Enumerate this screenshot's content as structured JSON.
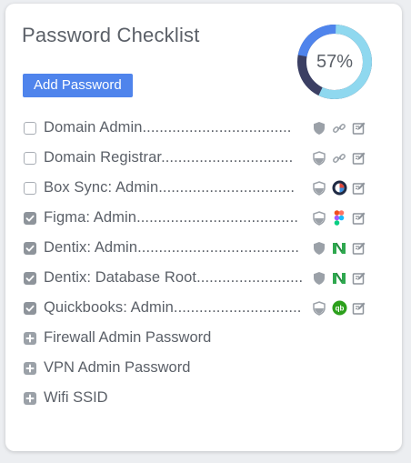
{
  "checklist": {
    "title": "Password Checklist",
    "add_button_label": "Add Password",
    "progress_label": "57%",
    "progress_fraction": 0.57,
    "colors": {
      "accent": "#4f84ec",
      "donut_dark": "#3b3f63",
      "donut_light": "#8fd8ef",
      "donut_blue": "#4f84ec"
    },
    "items": [
      {
        "label": "Domain Admin...................................",
        "checked": false,
        "shield": "shield-solid-icon",
        "service": "link-icon"
      },
      {
        "label": "Domain Registrar...............................",
        "checked": false,
        "shield": "shield-half-icon",
        "service": "link-icon"
      },
      {
        "label": "Box Sync: Admin................................",
        "checked": false,
        "shield": "shield-half-icon",
        "service": "box-sync-icon"
      },
      {
        "label": "Figma: Admin......................................",
        "checked": true,
        "shield": "shield-half-icon",
        "service": "figma-icon"
      },
      {
        "label": "Dentix: Admin......................................",
        "checked": true,
        "shield": "shield-solid-icon",
        "service": "dentix-icon"
      },
      {
        "label": "Dentix: Database Root.........................",
        "checked": true,
        "shield": "shield-solid-icon",
        "service": "dentix-icon"
      },
      {
        "label": "Quickbooks: Admin..............................",
        "checked": true,
        "shield": "shield-half-icon",
        "service": "quickbooks-icon"
      }
    ],
    "suggestions": [
      {
        "label": "Firewall Admin Password"
      },
      {
        "label": "VPN Admin Password"
      },
      {
        "label": "Wifi SSID"
      }
    ],
    "quickbooks_text": "qb"
  }
}
